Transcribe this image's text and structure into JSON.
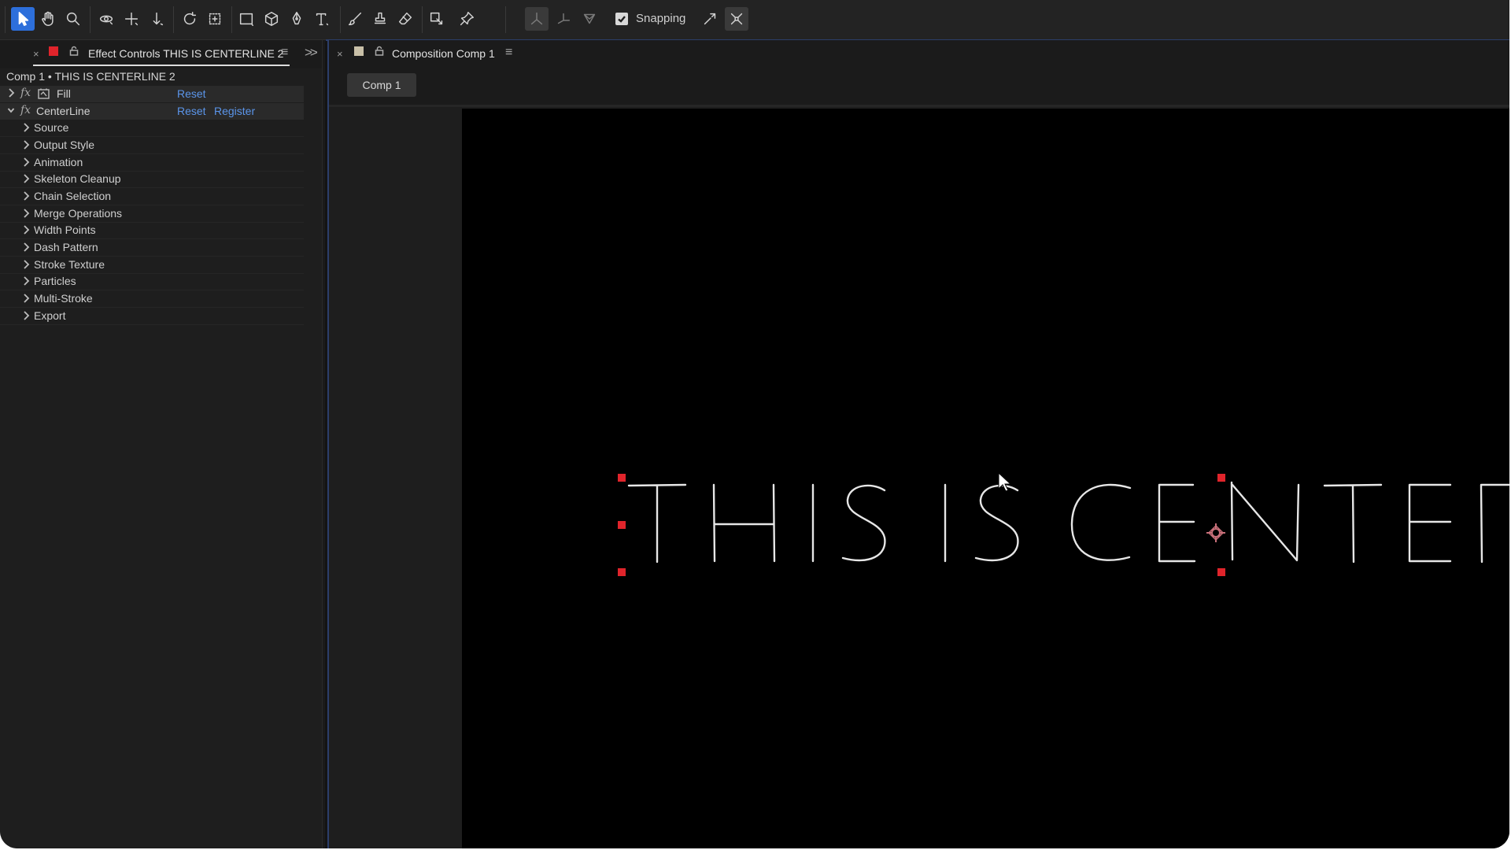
{
  "toolbar": {
    "tools": [
      {
        "name": "selection-tool-icon",
        "active": true
      },
      {
        "name": "hand-tool-icon"
      },
      {
        "name": "zoom-tool-icon"
      },
      {
        "name": "orbit-camera-tool-icon"
      },
      {
        "name": "pan-camera-tool-icon"
      },
      {
        "name": "dolly-camera-tool-icon"
      },
      {
        "name": "rotation-tool-icon"
      },
      {
        "name": "pan-behind-tool-icon"
      },
      {
        "name": "rectangle-tool-icon"
      },
      {
        "name": "3d-cube-tool-icon"
      },
      {
        "name": "pen-tool-icon"
      },
      {
        "name": "type-tool-icon"
      },
      {
        "name": "brush-tool-icon"
      },
      {
        "name": "clone-stamp-tool-icon"
      },
      {
        "name": "eraser-tool-icon"
      },
      {
        "name": "roto-brush-tool-icon"
      },
      {
        "name": "puppet-pin-tool-icon"
      }
    ],
    "axis_tools": [
      "local-axis-icon",
      "world-axis-icon",
      "view-axis-icon"
    ],
    "snapping_label": "Snapping",
    "snapping_checked": true
  },
  "effect_panel": {
    "tab_title": "Effect Controls THIS IS CENTERLINE 2",
    "tab_close": "×",
    "label_color": "#e0242b",
    "layer_header": "Comp 1 • THIS IS CENTERLINE 2",
    "effects": [
      {
        "name": "Fill",
        "expanded": false,
        "reset": "Reset"
      },
      {
        "name": "CenterLine",
        "expanded": true,
        "reset": "Reset",
        "register": "Register"
      }
    ],
    "groups": [
      "Source",
      "Output Style",
      "Animation",
      "Skeleton Cleanup",
      "Chain Selection",
      "Merge Operations",
      "Width Points",
      "Dash Pattern",
      "Stroke Texture",
      "Particles",
      "Multi-Stroke",
      "Export"
    ]
  },
  "composition_panel": {
    "tab_title": "Composition Comp 1",
    "tab_close": "×",
    "label_color": "#c9c0a8",
    "comp_pill": "Comp 1"
  },
  "colors": {
    "accent": "#2d6fdb",
    "link": "#5b95ea",
    "handle": "#e0242b"
  }
}
